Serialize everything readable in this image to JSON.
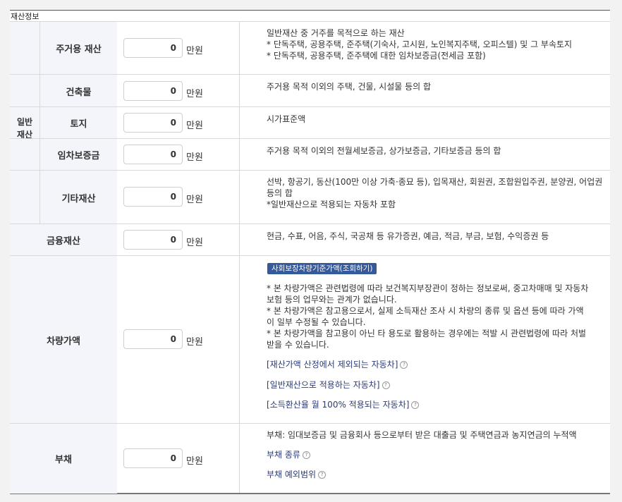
{
  "section_title": "재산정보",
  "group_label": "일반재산",
  "rows": [
    {
      "label": "주거용 재산",
      "value": "0",
      "unit": "만원",
      "desc": [
        "일반재산 중 거주를 목적으로 하는 재산",
        "* 단독주택, 공용주택, 준주택(기숙사, 고시원, 노인복지주택, 오피스텔) 및 그 부속토지",
        "* 단독주택, 공용주택, 준주택에 대한 임차보증금(전세금 포함)"
      ]
    },
    {
      "label": "건축물",
      "value": "0",
      "unit": "만원",
      "desc": [
        "주거용 목적 이외의 주택, 건물, 시설물 등의 합"
      ]
    },
    {
      "label": "토지",
      "value": "0",
      "unit": "만원",
      "desc": [
        "시가표준액"
      ]
    },
    {
      "label": "임차보증금",
      "value": "0",
      "unit": "만원",
      "desc": [
        "주거용 목적 이외의 전월세보증금, 상가보증금, 기타보증금 등의 합"
      ]
    },
    {
      "label": "기타재산",
      "value": "0",
      "unit": "만원",
      "desc": [
        "선박, 항공기, 동산(100만 이상 가축·종묘 등), 입목재산, 회원권, 조합원입주권, 분양권, 어업권",
        "등의 합",
        "*일반재산으로 적용되는 자동차 포함"
      ]
    },
    {
      "label": "금융재산",
      "value": "0",
      "unit": "만원",
      "desc": [
        "현금, 수표, 어음, 주식, 국공채 등 유가증권, 예금, 적금, 부금, 보험, 수익증권 등"
      ]
    },
    {
      "label": "차량가액",
      "value": "0",
      "unit": "만원",
      "button": "사회보장차량기준가액(조회하기)",
      "desc": [
        "* 본 차량가액은 관련법령에 따라 보건복지부장관이 정하는 정보로써, 중고차매매 및 자동차",
        "보험 등의 업무와는 관계가 없습니다.",
        "* 본 차량가액은 참고용으로서, 실제 소득재산 조사 시 차량의 종류 및 옵션 등에 따라 가액",
        "이 일부 수정될 수 있습니다.",
        "* 본 차량가액을 참고용이 아닌 타 용도로 활용하는 경우에는 적발 시 관련법령에 따라 처벌",
        "받을 수 있습니다."
      ],
      "links": [
        "[재산가액 산정에서 제외되는 자동차]",
        "[일반재산으로 적용하는 자동차]",
        "[소득환산율 월 100% 적용되는 자동차]"
      ]
    },
    {
      "label": "부채",
      "value": "0",
      "unit": "만원",
      "desc": [
        "부채: 임대보증금 및 금융회사 등으로부터 받은 대출금 및 주택연금과 농지연금의 누적액"
      ],
      "links": [
        "부채 종류",
        "부채 예외범위"
      ]
    }
  ],
  "info_icon": "help-circle-icon",
  "colors": {
    "label_bg": "#f4f5fa",
    "button_bg": "#345a9c",
    "link": "#2b3b7a"
  }
}
